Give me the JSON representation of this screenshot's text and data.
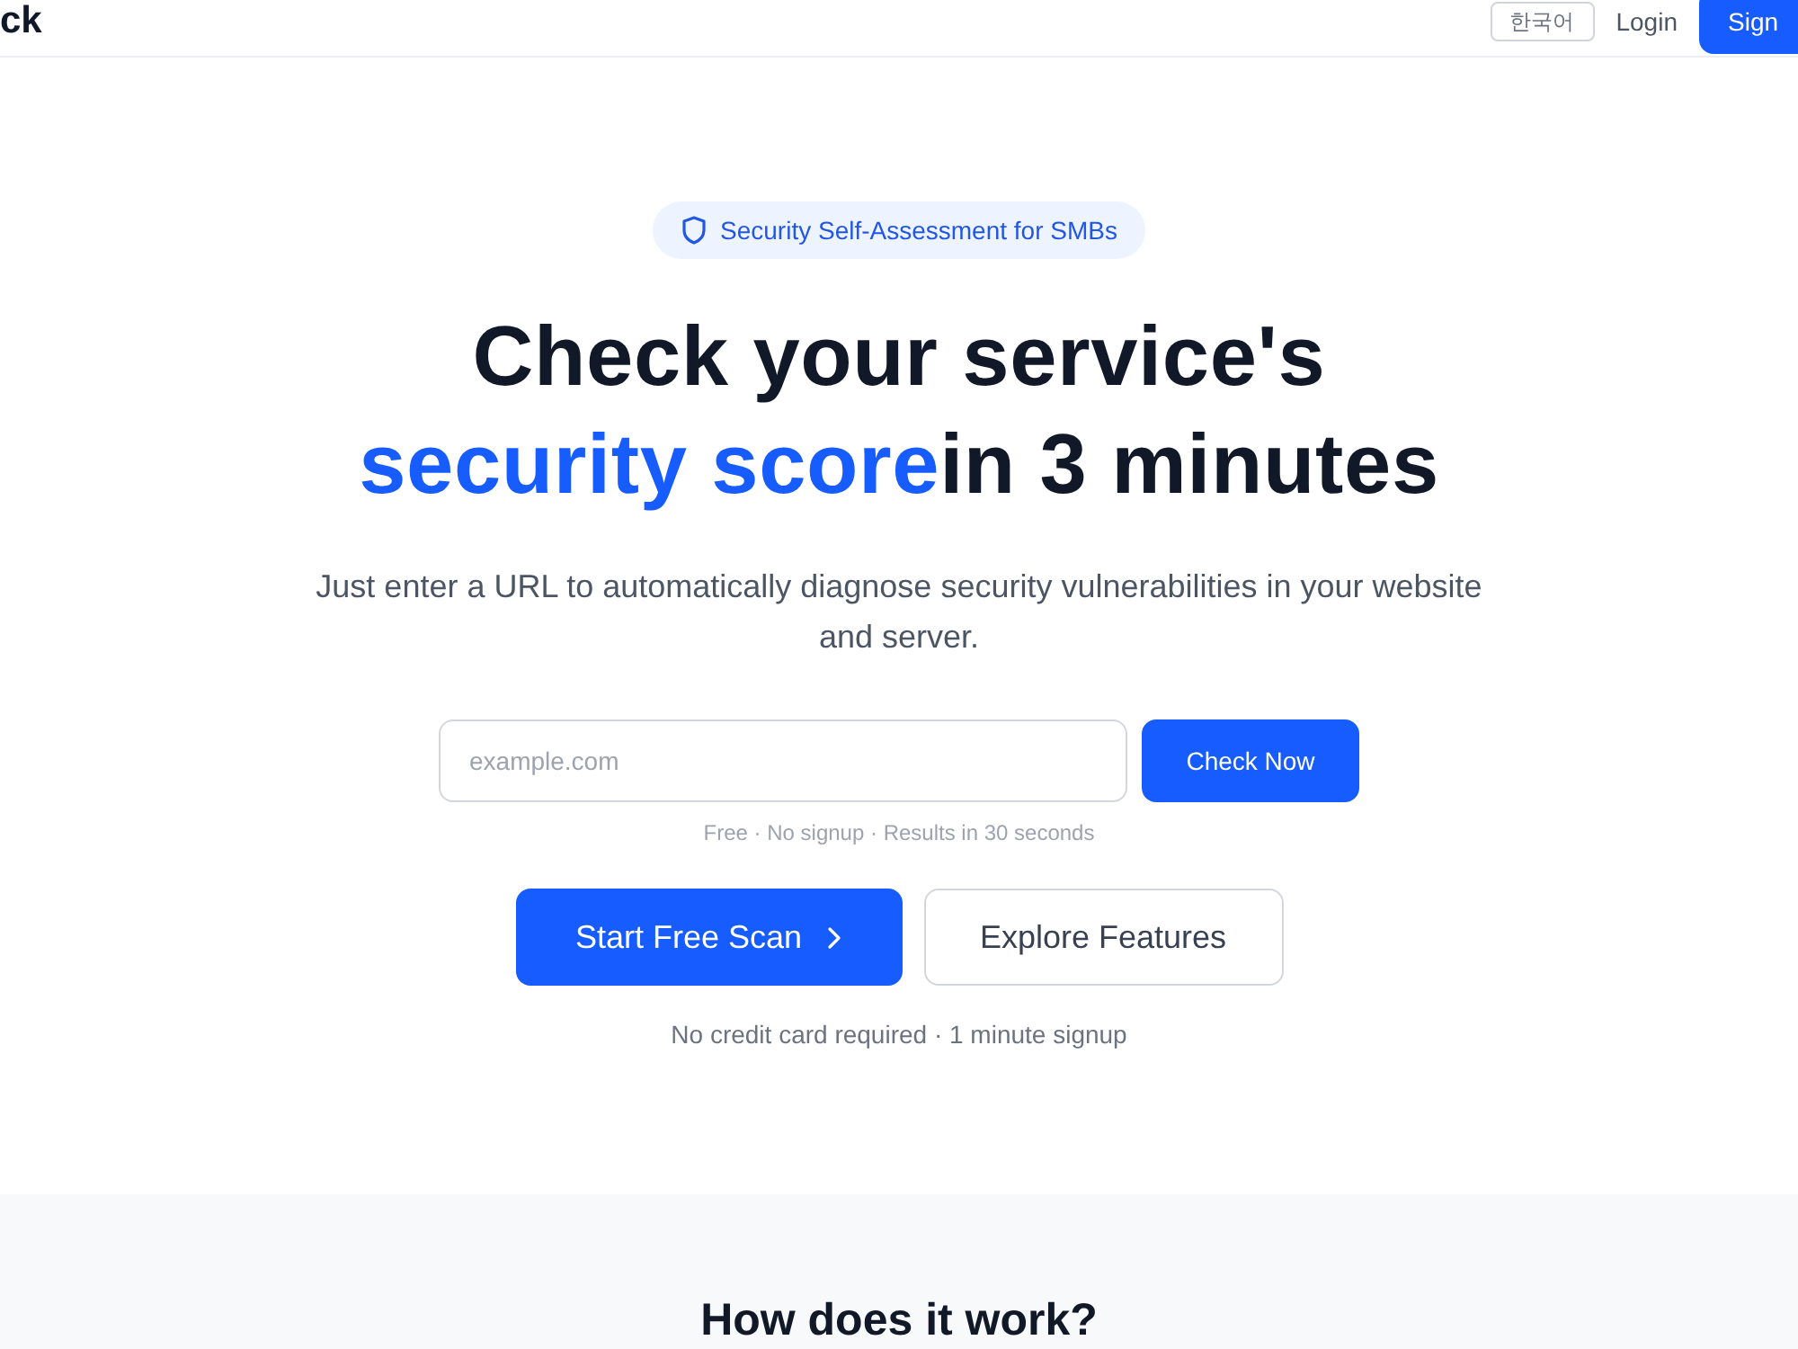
{
  "header": {
    "logo": "ck",
    "language_button": "한국어",
    "login_link": "Login",
    "signup_button": "Sign"
  },
  "hero": {
    "badge": "Security Self-Assessment for SMBs",
    "heading": {
      "line_1": "Check your service's",
      "highlight": "security score",
      "rest": "in 3 minutes"
    },
    "subtitle": "Just enter a URL to automatically diagnose security vulnerabilities in your website and server.",
    "url_field": {
      "placeholder": "example.com"
    },
    "check_button": "Check Now",
    "check_note": "Free · No signup · Results in 30 seconds",
    "primary_button": "Start Free Scan",
    "secondary_button": "Explore Features",
    "signup_note": "No credit card required · 1 minute signup"
  },
  "how_it_works": {
    "heading": "How does it work?"
  }
}
